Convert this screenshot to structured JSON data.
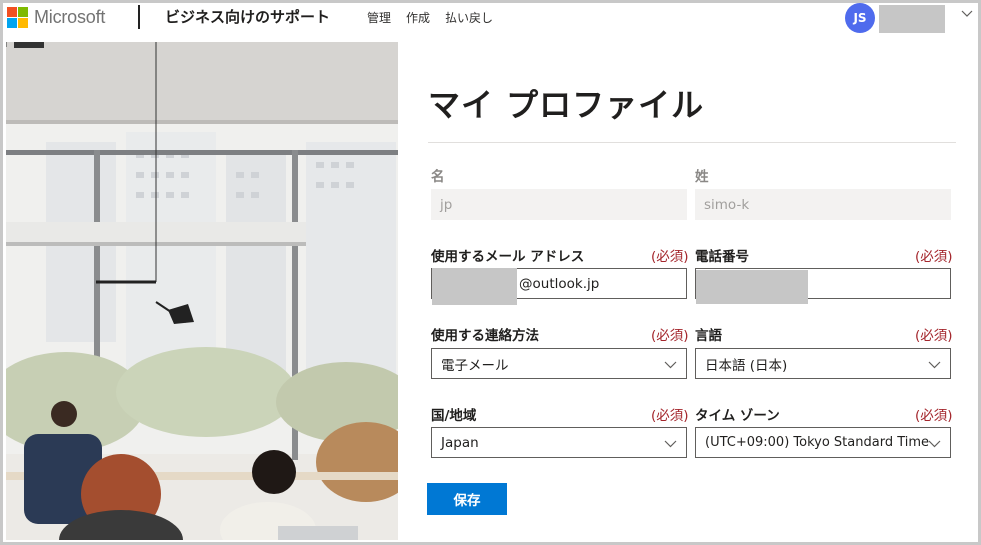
{
  "header": {
    "brand": "Microsoft",
    "app_title": "ビジネス向けのサポート",
    "nav": [
      "管理",
      "作成",
      "払い戻し"
    ],
    "avatar_initials": "JS",
    "brand_colors": {
      "red": "#f25022",
      "green": "#7fba00",
      "blue": "#00a4ef",
      "yellow": "#ffb900"
    },
    "avatar_color": "#4f6bed"
  },
  "profile": {
    "title": "マイ プロファイル",
    "first_name": {
      "label": "名",
      "value": "jp"
    },
    "last_name": {
      "label": "姓",
      "value": "simo-k"
    },
    "email": {
      "label": "使用するメール アドレス",
      "required": "(必須)",
      "value": "@outlook.jp"
    },
    "phone": {
      "label": "電話番号",
      "required": "(必須)",
      "value": ""
    },
    "contact_method": {
      "label": "使用する連絡方法",
      "required": "(必須)",
      "value": "電子メール"
    },
    "language": {
      "label": "言語",
      "required": "(必須)",
      "value": "日本語 (日本)"
    },
    "country": {
      "label": "国/地域",
      "required": "(必須)",
      "value": "Japan"
    },
    "timezone": {
      "label": "タイム ゾーン",
      "required": "(必須)",
      "value": "(UTC+09:00) Tokyo Standard Time"
    },
    "save_label": "保存"
  },
  "colors": {
    "accent": "#0078d4",
    "required": "#a4262c"
  }
}
